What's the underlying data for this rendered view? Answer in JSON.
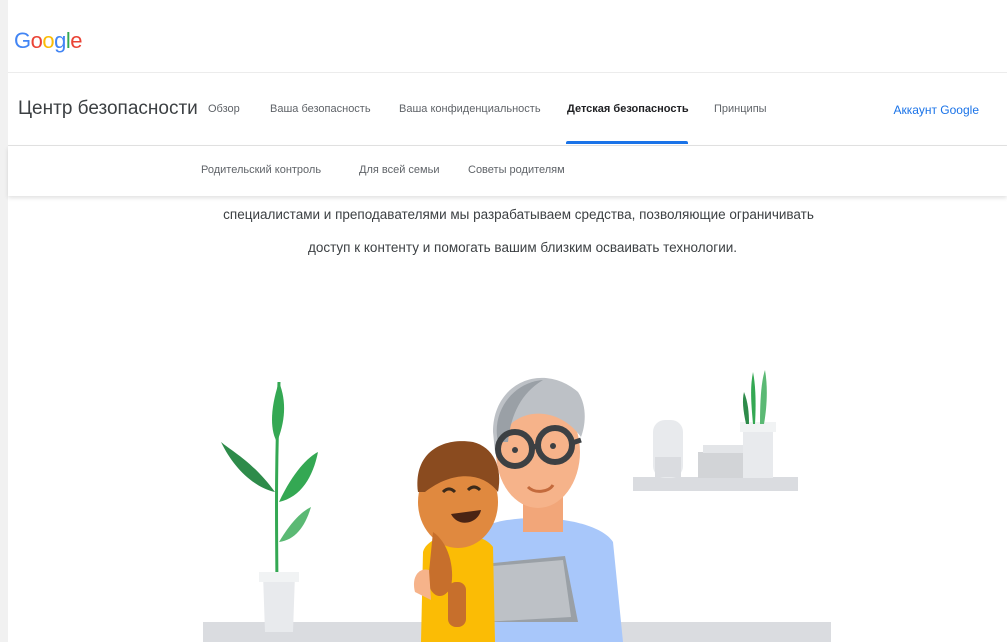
{
  "logo": {
    "letters": [
      "G",
      "o",
      "o",
      "g",
      "l",
      "e"
    ],
    "colors": [
      "#4285F4",
      "#EA4335",
      "#FBBC05",
      "#4285F4",
      "#34A853",
      "#EA4335"
    ]
  },
  "header": {
    "site_title": "Центр безопасности",
    "account_link": "Аккаунт Google"
  },
  "nav": {
    "tabs": [
      {
        "label": "Обзор",
        "active": false
      },
      {
        "label": "Ваша безопасность",
        "active": false
      },
      {
        "label": "Ваша конфиденциальность",
        "active": false
      },
      {
        "label": "Детская безопасность",
        "active": true
      },
      {
        "label": "Принципы",
        "active": false
      }
    ]
  },
  "subnav": {
    "items": [
      "Родительский контроль",
      "Для всей семьи",
      "Советы родителям"
    ]
  },
  "main": {
    "intro_line1": "специалистами и преподавателями мы разрабатываем средства, позволяющие ограничивать",
    "intro_line2": "доступ к контенту и помогать вашим близким осваивать технологии."
  },
  "colors": {
    "accent": "#1a73e8",
    "plant_green": "#34a853",
    "shirt_blue": "#a8c7fa",
    "shirt_yellow": "#fbbc05"
  }
}
